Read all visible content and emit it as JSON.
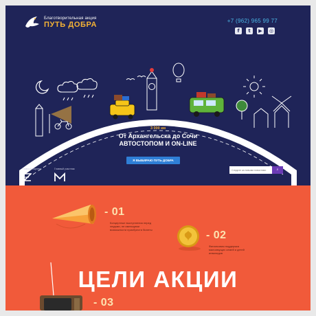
{
  "logo": {
    "subtitle": "Благотворительная акция",
    "title": "ПУТЬ ДОБРА"
  },
  "header": {
    "phone": "+7 (962) 965 99 77",
    "socials": [
      {
        "icon": "facebook-icon",
        "glyph": "f"
      },
      {
        "icon": "twitter-icon",
        "glyph": "t"
      },
      {
        "icon": "youtube-icon",
        "glyph": "▶"
      },
      {
        "icon": "instagram-icon",
        "glyph": "◎"
      }
    ]
  },
  "hero": {
    "distance": "3 000 км",
    "headline_line1": "От Архангельска до Сочи",
    "headline_line2": "АВТОСТОПОМ И ON-LINE",
    "cta_label": "Я ВЫБИРАЮ ПУТЬ ДОБРА",
    "search_placeholder": "Следите за новыми новостями",
    "search_button": "⌕",
    "partners": [
      {
        "label": "Главный партнер:",
        "logo": "Z"
      },
      {
        "label": "Главный участник:",
        "logo": "M"
      }
    ]
  },
  "goals": {
    "title": "ЦЕЛИ АКЦИИ",
    "items": [
      {
        "number": "- 01",
        "description": "Концертные выступления перед людьми, не имеющими возможности приобрести билеты"
      },
      {
        "number": "- 02",
        "description": "Финансовая поддержка малоимущих семей и детей инвалидов"
      },
      {
        "number": "- 03",
        "description": ""
      }
    ]
  },
  "colors": {
    "hero_bg": "#1f2458",
    "accent_orange": "#f15a3a",
    "gold": "#f5b335",
    "phone_blue": "#4cb8e8",
    "cta_blue": "#2f7fd6"
  }
}
